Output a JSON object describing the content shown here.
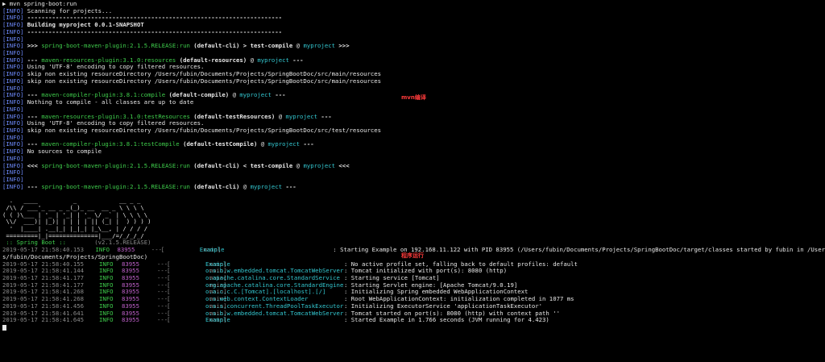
{
  "prompt_line": "▶ mvn spring-boot:run",
  "info_tag": "[INFO]",
  "maven_lines": [
    [
      {
        "t": "Scanning for projects...",
        "c": "w"
      }
    ],
    [
      {
        "t": "------------------------------------------------------------------------",
        "c": "b"
      }
    ],
    [
      {
        "t": "Building myproject 0.0.1-SNAPSHOT",
        "c": "b"
      }
    ],
    [
      {
        "t": "------------------------------------------------------------------------",
        "c": "b"
      }
    ],
    [],
    [
      {
        "t": ">>> ",
        "c": "b"
      },
      {
        "t": "spring-boot-maven-plugin:2.1.5.RELEASE:run",
        "c": "g"
      },
      {
        "t": " (default-cli)",
        "c": "b"
      },
      {
        "t": " > ",
        "c": "b"
      },
      {
        "t": "test-compile",
        "c": "b"
      },
      {
        "t": " @ ",
        "c": "w"
      },
      {
        "t": "myproject",
        "c": "c"
      },
      {
        "t": " >>>",
        "c": "b"
      }
    ],
    [],
    [
      {
        "t": "--- ",
        "c": "b"
      },
      {
        "t": "maven-resources-plugin:3.1.0:resources",
        "c": "g"
      },
      {
        "t": " (default-resources)",
        "c": "b"
      },
      {
        "t": " @ ",
        "c": "w"
      },
      {
        "t": "myproject",
        "c": "c"
      },
      {
        "t": " ---",
        "c": "b"
      }
    ],
    [
      {
        "t": "Using 'UTF-8' encoding to copy filtered resources.",
        "c": "w"
      }
    ],
    [
      {
        "t": "skip non existing resourceDirectory /Users/fubin/Documents/Projects/SpringBootDoc/src/main/resources",
        "c": "w"
      }
    ],
    [
      {
        "t": "skip non existing resourceDirectory /Users/fubin/Documents/Projects/SpringBootDoc/src/main/resources",
        "c": "w"
      }
    ],
    [],
    [
      {
        "t": "--- ",
        "c": "b"
      },
      {
        "t": "maven-compiler-plugin:3.8.1:compile",
        "c": "g"
      },
      {
        "t": " (default-compile)",
        "c": "b"
      },
      {
        "t": " @ ",
        "c": "w"
      },
      {
        "t": "myproject",
        "c": "c"
      },
      {
        "t": " ---",
        "c": "b"
      }
    ],
    [
      {
        "t": "Nothing to compile - all classes are up to date",
        "c": "w"
      }
    ],
    [],
    [
      {
        "t": "--- ",
        "c": "b"
      },
      {
        "t": "maven-resources-plugin:3.1.0:testResources",
        "c": "g"
      },
      {
        "t": " (default-testResources)",
        "c": "b"
      },
      {
        "t": " @ ",
        "c": "w"
      },
      {
        "t": "myproject",
        "c": "c"
      },
      {
        "t": " ---",
        "c": "b"
      }
    ],
    [
      {
        "t": "Using 'UTF-8' encoding to copy filtered resources.",
        "c": "w"
      }
    ],
    [
      {
        "t": "skip non existing resourceDirectory /Users/fubin/Documents/Projects/SpringBootDoc/src/test/resources",
        "c": "w"
      }
    ],
    [],
    [
      {
        "t": "--- ",
        "c": "b"
      },
      {
        "t": "maven-compiler-plugin:3.8.1:testCompile",
        "c": "g"
      },
      {
        "t": " (default-testCompile)",
        "c": "b"
      },
      {
        "t": " @ ",
        "c": "w"
      },
      {
        "t": "myproject",
        "c": "c"
      },
      {
        "t": " ---",
        "c": "b"
      }
    ],
    [
      {
        "t": "No sources to compile",
        "c": "w"
      }
    ],
    [],
    [
      {
        "t": "<<< ",
        "c": "b"
      },
      {
        "t": "spring-boot-maven-plugin:2.1.5.RELEASE:run",
        "c": "g"
      },
      {
        "t": " (default-cli)",
        "c": "b"
      },
      {
        "t": " < ",
        "c": "b"
      },
      {
        "t": "test-compile",
        "c": "b"
      },
      {
        "t": " @ ",
        "c": "w"
      },
      {
        "t": "myproject",
        "c": "c"
      },
      {
        "t": " <<<",
        "c": "b"
      }
    ],
    [],
    [],
    [
      {
        "t": "--- ",
        "c": "b"
      },
      {
        "t": "spring-boot-maven-plugin:2.1.5.RELEASE:run",
        "c": "g"
      },
      {
        "t": " (default-cli)",
        "c": "b"
      },
      {
        "t": " @ ",
        "c": "w"
      },
      {
        "t": "myproject",
        "c": "c"
      },
      {
        "t": " ---",
        "c": "b"
      }
    ]
  ],
  "banner_lines": [
    "",
    "  .   ____          _            __ _ _",
    " /\\\\ / ___'_ __ _ _(_)_ __  __ _ \\ \\ \\ \\",
    "( ( )\\___ | '_ | '_| | '_ \\/ _` | \\ \\ \\ \\",
    " \\\\/  ___)| |_)| | | | | || (_| |  ) ) ) )",
    "  '  |____| .__|_| |_|_| |_\\__, | / / / /",
    " =========|_|==============|___/=/_/_/_/"
  ],
  "banner_footer": {
    "label": " :: Spring Boot :: ",
    "version": "       (v2.1.5.RELEASE)"
  },
  "log_lines": [
    {
      "ts": "2019-05-17 21:58:40.153",
      "lvl": "INFO",
      "pid": "83955",
      "sep": "---",
      "thr": "[           main]",
      "logger": "Example",
      "msg": ": Starting Example on 192.168.11.122 with PID 83955 (/Users/fubin/Documents/Projects/SpringBootDoc/target/classes started by fubin in /User"
    },
    {
      "wrap": "s/fubin/Documents/Projects/SpringBootDoc)"
    },
    {
      "ts": "2019-05-17 21:58:40.155",
      "lvl": "INFO",
      "pid": "83955",
      "sep": "---",
      "thr": "[           main]",
      "logger": "Example",
      "msg": ": No active profile set, falling back to default profiles: default"
    },
    {
      "ts": "2019-05-17 21:58:41.144",
      "lvl": "INFO",
      "pid": "83955",
      "sep": "---",
      "thr": "[           main]",
      "logger": "o.s.b.w.embedded.tomcat.TomcatWebServer",
      "msg": ": Tomcat initialized with port(s): 8080 (http)"
    },
    {
      "ts": "2019-05-17 21:58:41.177",
      "lvl": "INFO",
      "pid": "83955",
      "sep": "---",
      "thr": "[           main]",
      "logger": "o.apache.catalina.core.StandardService",
      "msg": ": Starting service [Tomcat]"
    },
    {
      "ts": "2019-05-17 21:58:41.177",
      "lvl": "INFO",
      "pid": "83955",
      "sep": "---",
      "thr": "[           main]",
      "logger": "org.apache.catalina.core.StandardEngine",
      "msg": ": Starting Servlet engine: [Apache Tomcat/9.0.19]"
    },
    {
      "ts": "2019-05-17 21:58:41.268",
      "lvl": "INFO",
      "pid": "83955",
      "sep": "---",
      "thr": "[           main]",
      "logger": "o.a.c.c.C.[Tomcat].[localhost].[/]",
      "msg": ": Initializing Spring embedded WebApplicationContext"
    },
    {
      "ts": "2019-05-17 21:58:41.268",
      "lvl": "INFO",
      "pid": "83955",
      "sep": "---",
      "thr": "[           main]",
      "logger": "o.s.web.context.ContextLoader",
      "msg": ": Root WebApplicationContext: initialization completed in 1077 ms"
    },
    {
      "ts": "2019-05-17 21:58:41.456",
      "lvl": "INFO",
      "pid": "83955",
      "sep": "---",
      "thr": "[           main]",
      "logger": "o.s.s.concurrent.ThreadPoolTaskExecutor",
      "msg": ": Initializing ExecutorService 'applicationTaskExecutor'"
    },
    {
      "ts": "2019-05-17 21:58:41.641",
      "lvl": "INFO",
      "pid": "83955",
      "sep": "---",
      "thr": "[           main]",
      "logger": "o.s.b.w.embedded.tomcat.TomcatWebServer",
      "msg": ": Tomcat started on port(s): 8080 (http) with context path ''"
    },
    {
      "ts": "2019-05-17 21:58:41.645",
      "lvl": "INFO",
      "pid": "83955",
      "sep": "---",
      "thr": "[           main]",
      "logger": "Example",
      "msg": ": Started Example in 1.766 seconds (JVM running for 4.423)"
    }
  ],
  "annotations": {
    "compile": "mvn编译",
    "run": "程序运行"
  },
  "colors": {
    "background": "#000000",
    "info_tag": "#6f8cff",
    "plugin": "#3fce4c",
    "project": "#33c7d0",
    "pid": "#c061cb",
    "annotation": "#ff3b3b"
  }
}
